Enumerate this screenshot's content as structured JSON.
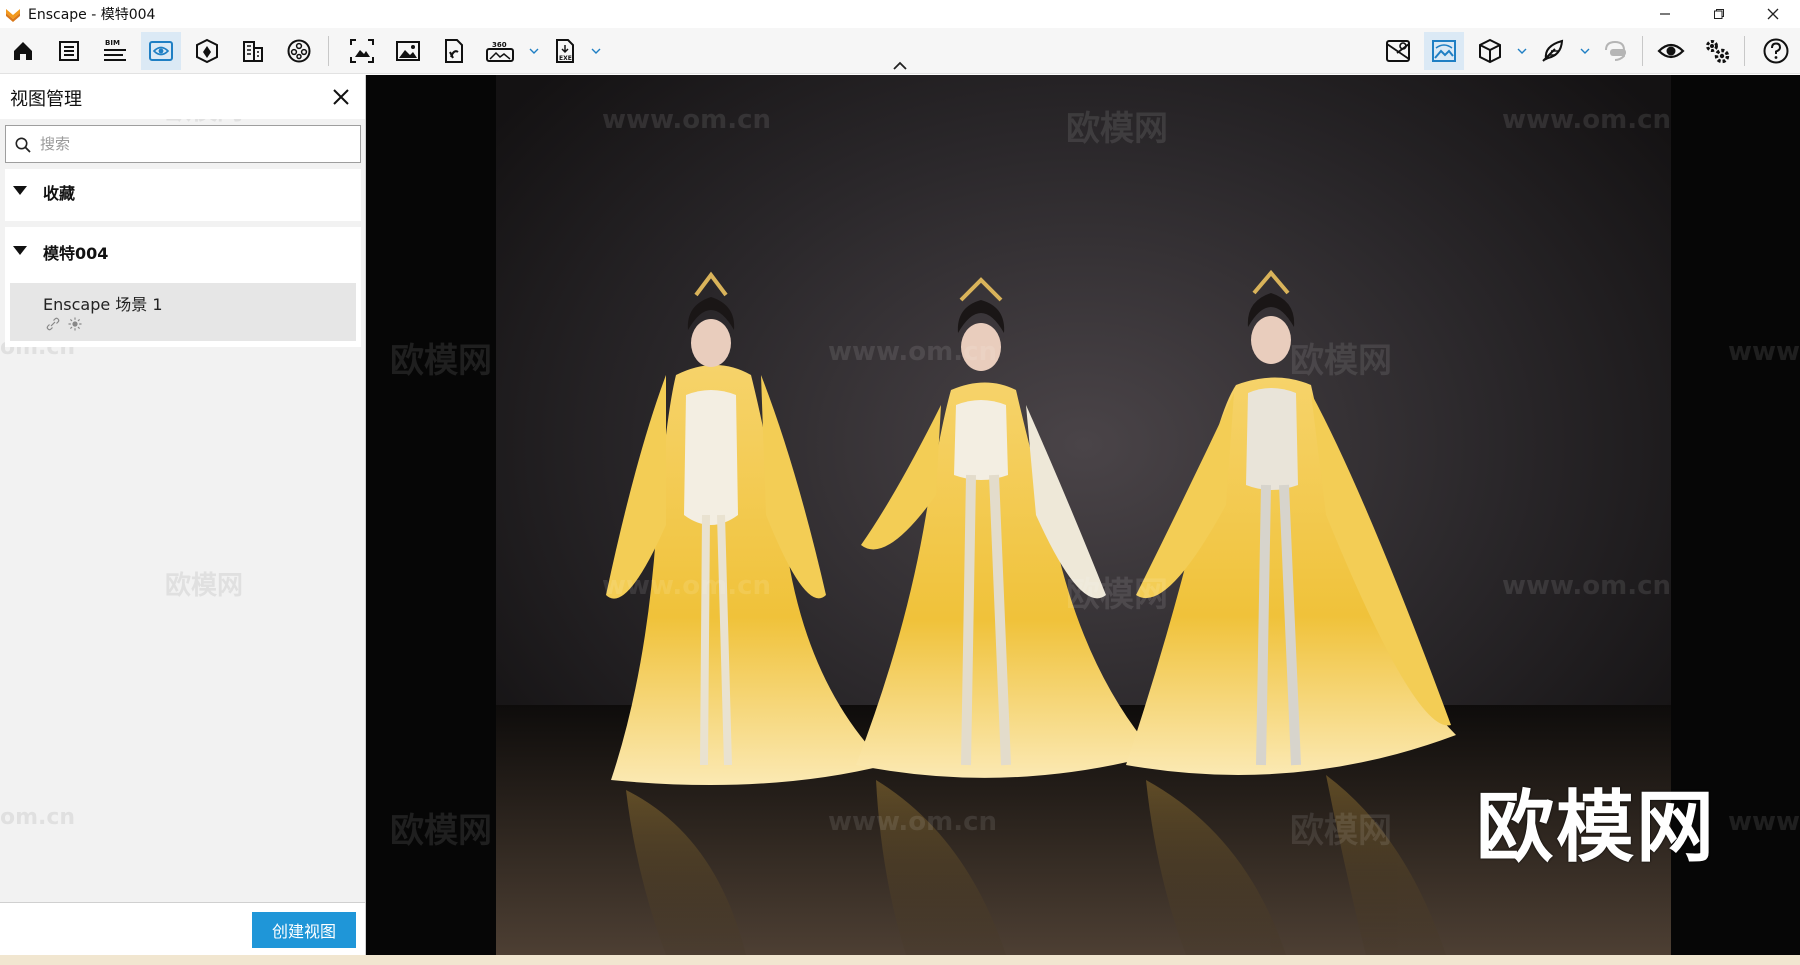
{
  "window": {
    "title": "Enscape - 模特004"
  },
  "sidebar": {
    "title": "视图管理",
    "search_placeholder": "搜索",
    "groups": [
      {
        "label": "收藏",
        "items": []
      },
      {
        "label": "模特004",
        "items": [
          {
            "name": "Enscape 场景 1"
          }
        ]
      }
    ],
    "create_button": "创建视图"
  },
  "viewport": {
    "watermarks": [
      "www.om.cn",
      "欧模网",
      "www.om.cn",
      "欧模网",
      "www.om.cn",
      "欧模网",
      "www.",
      "www.om.cn",
      "欧模网",
      "www.om.cn",
      "欧模网",
      "www.om.cn",
      "欧模网",
      "www.om.cn",
      "www."
    ],
    "brand_text": "欧模网"
  },
  "sidebar_watermarks": [
    "欧模网",
    "om.cn",
    "欧模网",
    "om.cn"
  ],
  "colors": {
    "accent": "#1f96d8",
    "active_tab": "#dbe9f5",
    "robe_yellow": "#f0c23a"
  }
}
